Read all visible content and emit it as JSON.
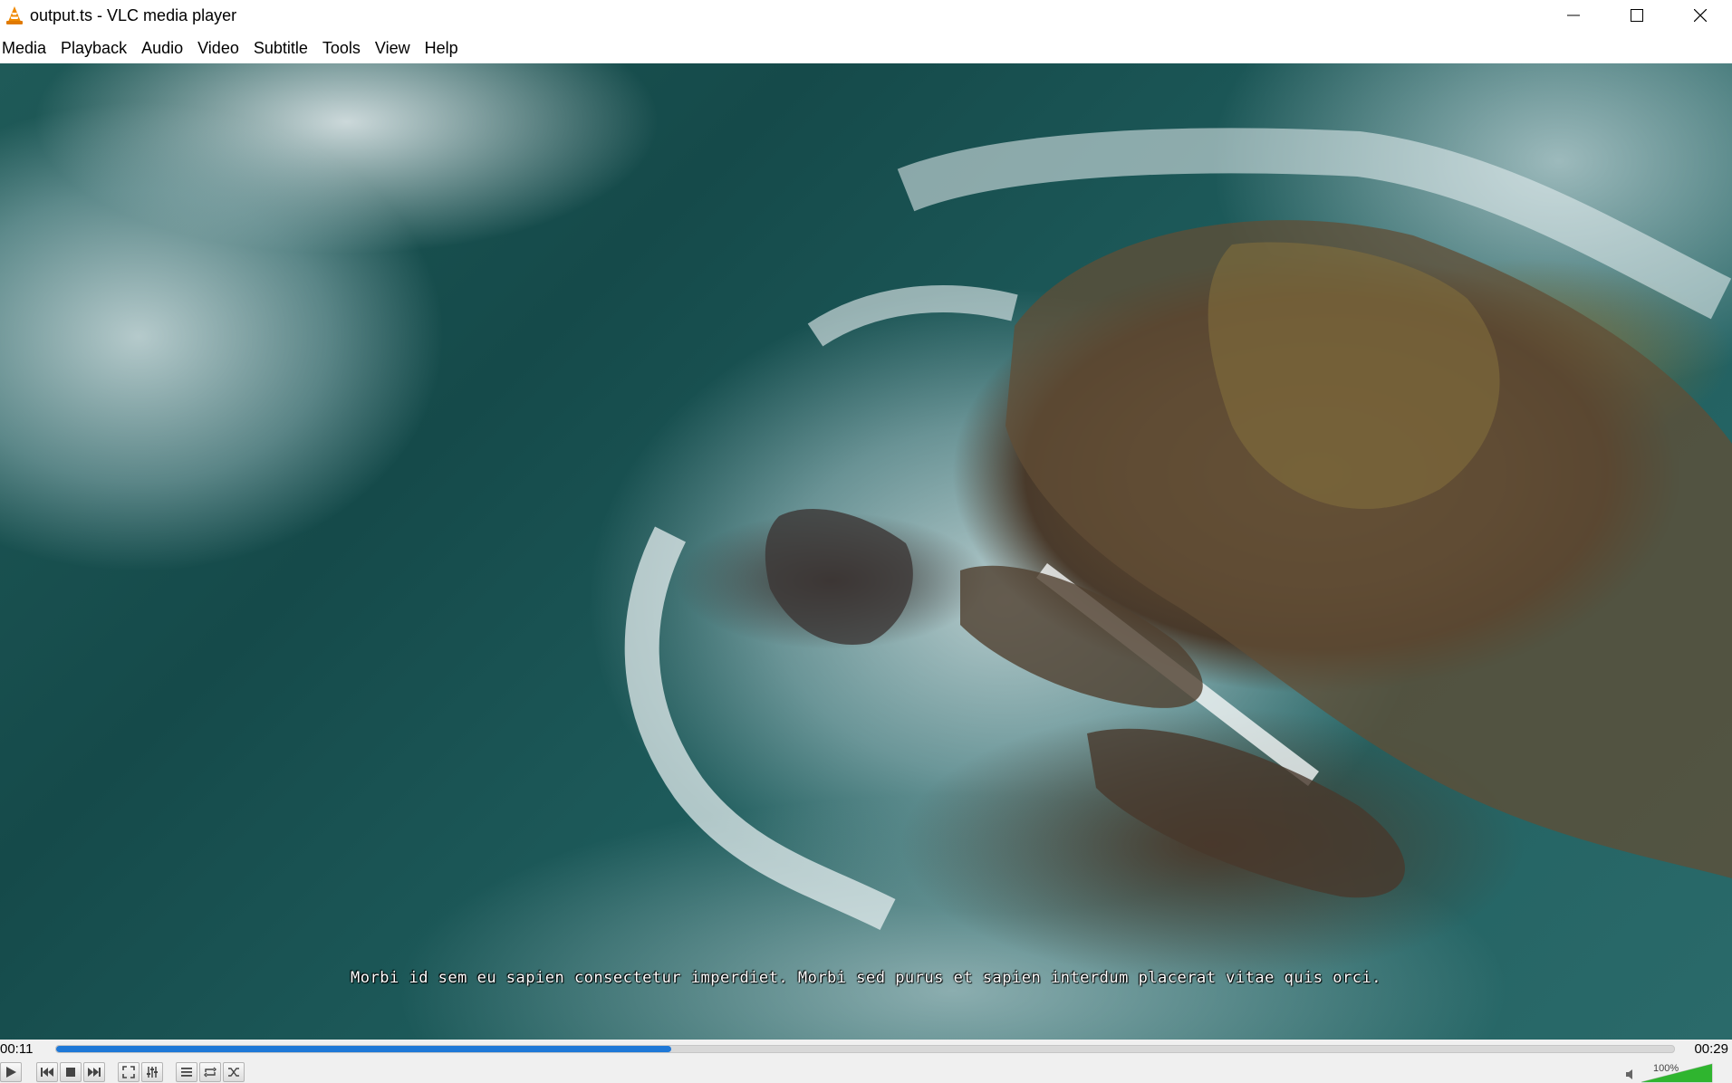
{
  "window": {
    "title": "output.ts - VLC media player",
    "icon": "vlc-cone-icon"
  },
  "menu": {
    "items": [
      "Media",
      "Playback",
      "Audio",
      "Video",
      "Subtitle",
      "Tools",
      "View",
      "Help"
    ]
  },
  "video": {
    "subtitle": "Morbi id sem eu sapien consectetur imperdiet. Morbi sed purus et sapien interdum placerat vitae quis orci."
  },
  "playback": {
    "elapsed": "00:11",
    "total": "00:29",
    "progress_fraction": 0.38
  },
  "controls": {
    "buttons": [
      "play-icon",
      "previous-icon",
      "stop-icon",
      "next-icon",
      "fullscreen-icon",
      "extended-settings-icon",
      "playlist-icon",
      "loop-icon",
      "shuffle-icon"
    ]
  },
  "volume": {
    "label": "100%",
    "level_fraction": 1.0,
    "color": "#2fb52f"
  },
  "colors": {
    "accent": "#1e78d7",
    "vlc_orange": "#f08a00"
  }
}
